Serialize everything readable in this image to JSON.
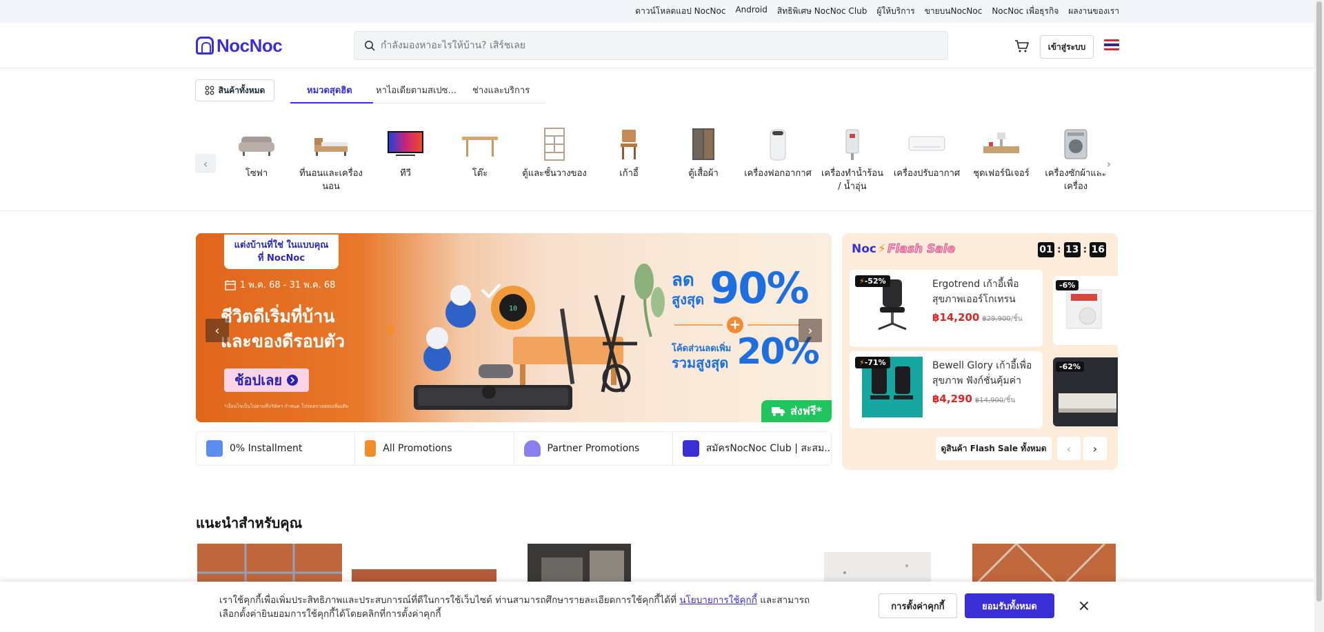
{
  "topbar": {
    "links": [
      "ดาวน์โหลดแอป NocNoc",
      "Android",
      "สิทธิพิเศษ NocNoc Club",
      "ผู้ให้บริการ",
      "ขายบนNocNoc",
      "NocNoc เพื่อธุรกิจ",
      "ผลงานของเรา"
    ]
  },
  "header": {
    "logo": "NocNoc",
    "search_placeholder": "กำลังมองหาอะไรให้บ้าน? เสิร์ชเลย",
    "login_label": "เข้าสู่ระบบ"
  },
  "tabs": {
    "all_products": "สินค้าทั้งหมด",
    "items": [
      "หมวดสุดฮิต",
      "หาไอเดียตามสเปซ...",
      "ช่างและบริการ"
    ]
  },
  "categories": [
    "โซฟา",
    "ที่นอนและเครื่องนอน",
    "ทีวี",
    "โต๊ะ",
    "ตู้และชั้นวางของ",
    "เก้าอี้",
    "ตู้เสื้อผ้า",
    "เครื่องฟอกอากาศ",
    "เครื่องทำน้ำร้อน / น้ำอุ่น",
    "เครื่องปรับอากาศ",
    "ชุดเฟอร์นิเจอร์",
    "เครื่องซักผ้าและเครื่อง"
  ],
  "hero": {
    "card_line1": "แต่งบ้านที่ใช่ ในแบบคุณ",
    "card_line2": "ที่ NocNoc",
    "date": "1 พ.ค. 68 - 31 พ.ค. 68",
    "title_line1": "ชีวิตดีเริ่มที่บ้าน",
    "title_line2": "และของดีรอบตัว",
    "cta": "ช้อปเลย",
    "fine_print": "*เงื่อนไขเป็นไปตามที่บริษัทฯ กำหนด โปรดตรวจสอบเพิ่มเติม",
    "discount_prefix": "ลด",
    "discount_sub": "สูงสุด",
    "discount_value": "90%",
    "extra_line1": "โค้ดส่วนลดเพิ่ม",
    "extra_line2": "รวมสูงสุด",
    "extra_value": "20%",
    "shipping": "ส่งฟรี*"
  },
  "promo_strip": [
    "0% Installment",
    "All Promotions",
    "Partner Promotions",
    "สมัครNocNoc Club | สะสม..."
  ],
  "flash_sale": {
    "title_prefix": "Noc",
    "title": "Flash Sale",
    "timer": [
      "01",
      "13",
      "16"
    ],
    "items": [
      {
        "badge": "-52%",
        "name": "Ergotrend เก้าอี้เพื่อสุขภาพเออร์โกเทรน รุ่น...",
        "price": "฿14,200",
        "original": "฿29,900",
        "unit": "/ชิ้น"
      },
      {
        "badge": "-71%",
        "name": "Bewell Glory เก้าอี้เพื่อสุขภาพ ฟังก์ชั่นคุ้มค่า ใน...",
        "price": "฿4,290",
        "original": "฿14,900",
        "unit": "/ชิ้น"
      }
    ],
    "mini_badges": [
      "-6%",
      "-62%"
    ],
    "view_all": "ดูสินค้า Flash Sale ทั้งหมด"
  },
  "recommend": {
    "title": "แนะนำสำหรับคุณ"
  },
  "cookie": {
    "text_before": "เราใช้คุกกี้เพื่อเพิ่มประสิทธิภาพและประสบการณ์ที่ดีในการใช้เว็บไซต์ ท่านสามารถศึกษารายละเอียดการใช้คุกกี้ได้ที่ ",
    "link": "นโยบายการใช้คุกกี้",
    "text_after": " และสามารถเลือกตั้งค่ายินยอมการใช้คุกกี้ได้โดยคลิกที่การตั้งค่าคุกกี้",
    "settings": "การตั้งค่าคุกกี้",
    "accept": "ยอมรับทั้งหมด"
  },
  "colors": {
    "brand": "#3a2fd6",
    "sale_red": "#e02424",
    "hero_orange": "#e0661a",
    "promo_blue": "#1d6fe0"
  }
}
